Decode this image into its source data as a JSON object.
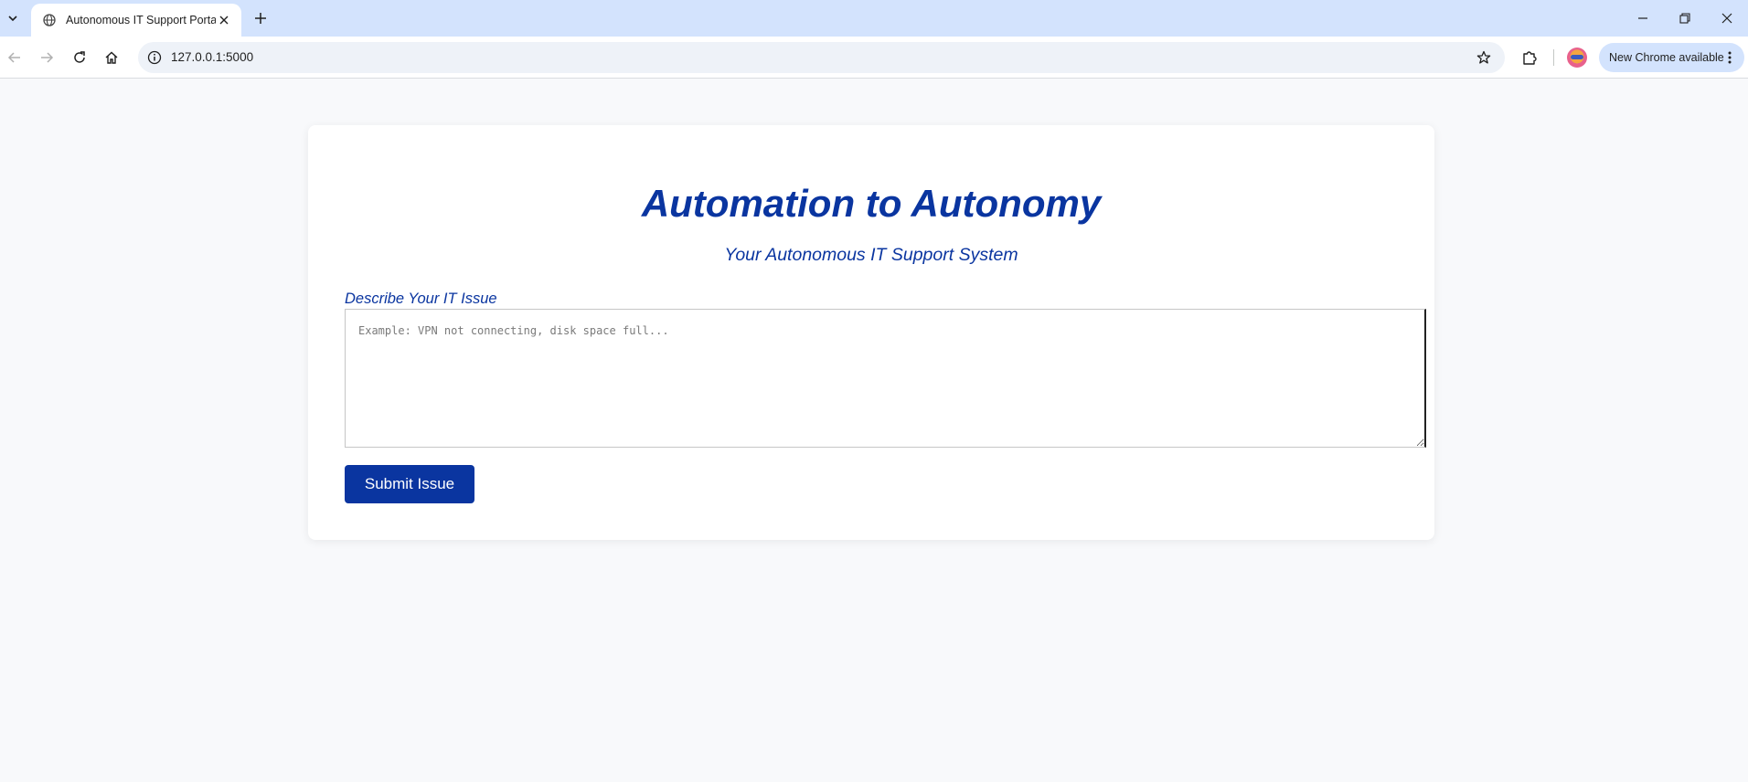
{
  "browser": {
    "tab_title": "Autonomous IT Support Portal",
    "url": "127.0.0.1:5000",
    "update_label": "New Chrome available",
    "icons": [
      "tab-search-icon",
      "globe-icon",
      "close-icon",
      "plus-icon",
      "minimize-icon",
      "restore-icon",
      "close-icon",
      "back-arrow-icon",
      "forward-arrow-icon",
      "reload-icon",
      "home-icon",
      "info-icon",
      "star-icon",
      "extensions-icon",
      "avatar",
      "more-vert-icon"
    ]
  },
  "page": {
    "title": "Automation to Autonomy",
    "subtitle": "Your Autonomous IT Support System",
    "issue_label": "Describe Your IT Issue",
    "issue_placeholder": "Example: VPN not connecting, disk space full...",
    "issue_value": "",
    "submit_label": "Submit Issue"
  },
  "colors": {
    "accent": "#0a35a0",
    "page_background": "#f8f9fb",
    "tabstrip": "#d3e3fd"
  }
}
